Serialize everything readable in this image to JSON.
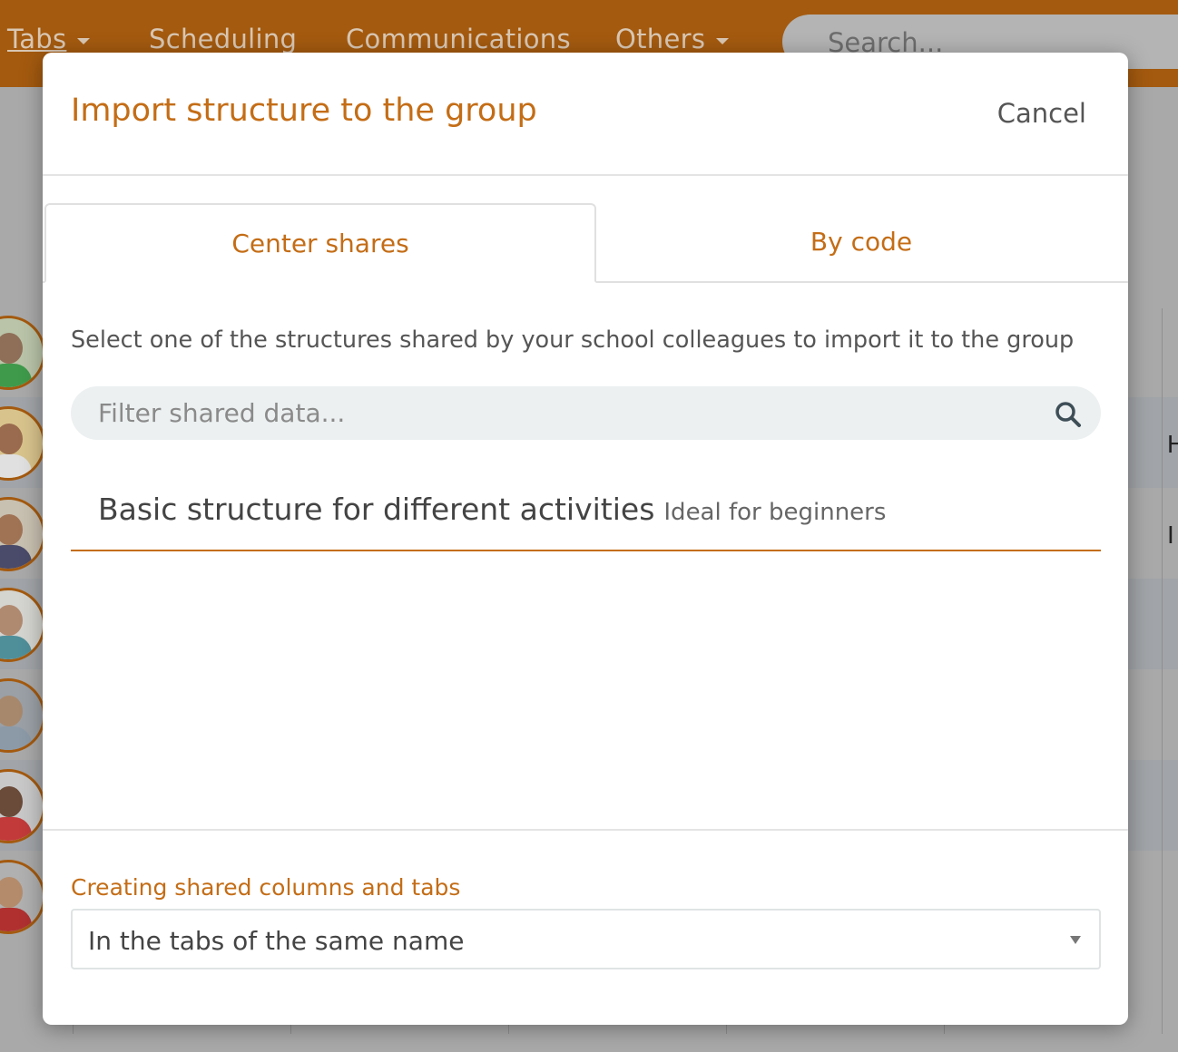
{
  "nav": {
    "tabs": "Tabs",
    "scheduling": "Scheduling",
    "communications": "Communications",
    "others": "Others",
    "search_placeholder": "Search..."
  },
  "background_letters": [
    "H",
    "I"
  ],
  "modal": {
    "title": "Import structure to the group",
    "cancel": "Cancel",
    "tabs": [
      {
        "label": "Center shares",
        "active": true
      },
      {
        "label": "By code",
        "active": false
      }
    ],
    "description": "Select one of the structures shared by your school colleagues to import it to the group",
    "filter_placeholder": "Filter shared data...",
    "structures": [
      {
        "title": "Basic structure for different activities",
        "subtitle": "Ideal for beginners"
      }
    ],
    "creation_label": "Creating shared columns and tabs",
    "creation_value": "In the tabs of the same name"
  },
  "colors": {
    "accent": "#c46d16",
    "topbar": "#a45a0f"
  }
}
